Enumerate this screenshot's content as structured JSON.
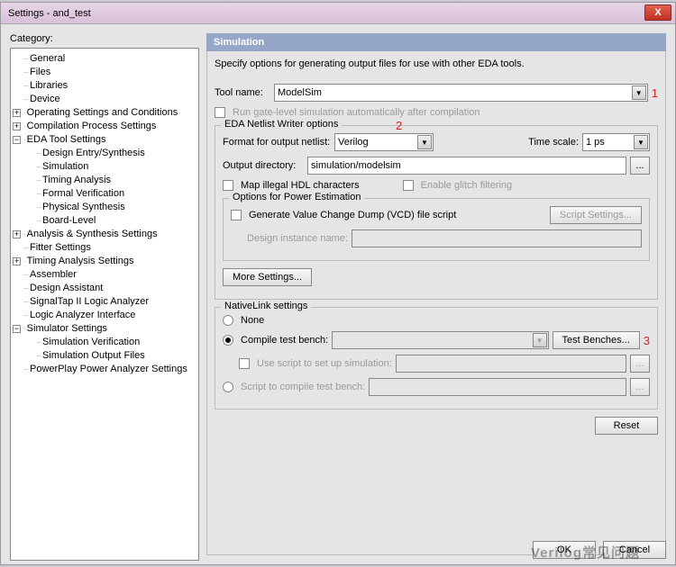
{
  "window": {
    "title": "Settings - and_test",
    "close": "X"
  },
  "left": {
    "category_label": "Category:"
  },
  "tree": {
    "general": "General",
    "files": "Files",
    "libraries": "Libraries",
    "device": "Device",
    "operating": "Operating Settings and Conditions",
    "compilation": "Compilation Process Settings",
    "eda": "EDA Tool Settings",
    "design_entry": "Design Entry/Synthesis",
    "simulation": "Simulation",
    "timing": "Timing Analysis",
    "formal": "Formal Verification",
    "physical": "Physical Synthesis",
    "board": "Board-Level",
    "analysis": "Analysis & Synthesis Settings",
    "fitter": "Fitter Settings",
    "timing_settings": "Timing Analysis Settings",
    "assembler": "Assembler",
    "design_assistant": "Design Assistant",
    "signaltap": "SignalTap II Logic Analyzer",
    "logic_analyzer": "Logic Analyzer Interface",
    "simulator": "Simulator Settings",
    "sim_verify": "Simulation Verification",
    "sim_output": "Simulation Output Files",
    "powerplay": "PowerPlay Power Analyzer Settings"
  },
  "panel": {
    "title": "Simulation",
    "desc": "Specify options for generating output files for use with other EDA tools.",
    "tool_name_label": "Tool name:",
    "tool_name_value": "ModelSim",
    "run_gate": "Run gate-level simulation automatically after compilation",
    "eda_writer": "EDA Netlist Writer options",
    "format_label": "Format for output netlist:",
    "format_value": "Verilog",
    "timescale_label": "Time scale:",
    "timescale_value": "1 ps",
    "output_dir_label": "Output directory:",
    "output_dir_value": "simulation/modelsim",
    "map_illegal": "Map illegal HDL characters",
    "enable_glitch": "Enable glitch filtering",
    "power_est": "Options for Power Estimation",
    "gen_vcd": "Generate Value Change Dump (VCD) file script",
    "script_settings": "Script Settings...",
    "design_inst": "Design instance name:",
    "more_settings": "More Settings...",
    "nativelink": "NativeLink settings",
    "none": "None",
    "compile_tb": "Compile test bench:",
    "test_benches": "Test Benches...",
    "use_script": "Use script to set up simulation:",
    "script_compile": "Script to compile test bench:",
    "reset": "Reset",
    "ok": "OK",
    "cancel": "Cancel",
    "anno1": "1",
    "anno2": "2",
    "anno3": "3"
  },
  "watermark": "Verilog常见问题"
}
